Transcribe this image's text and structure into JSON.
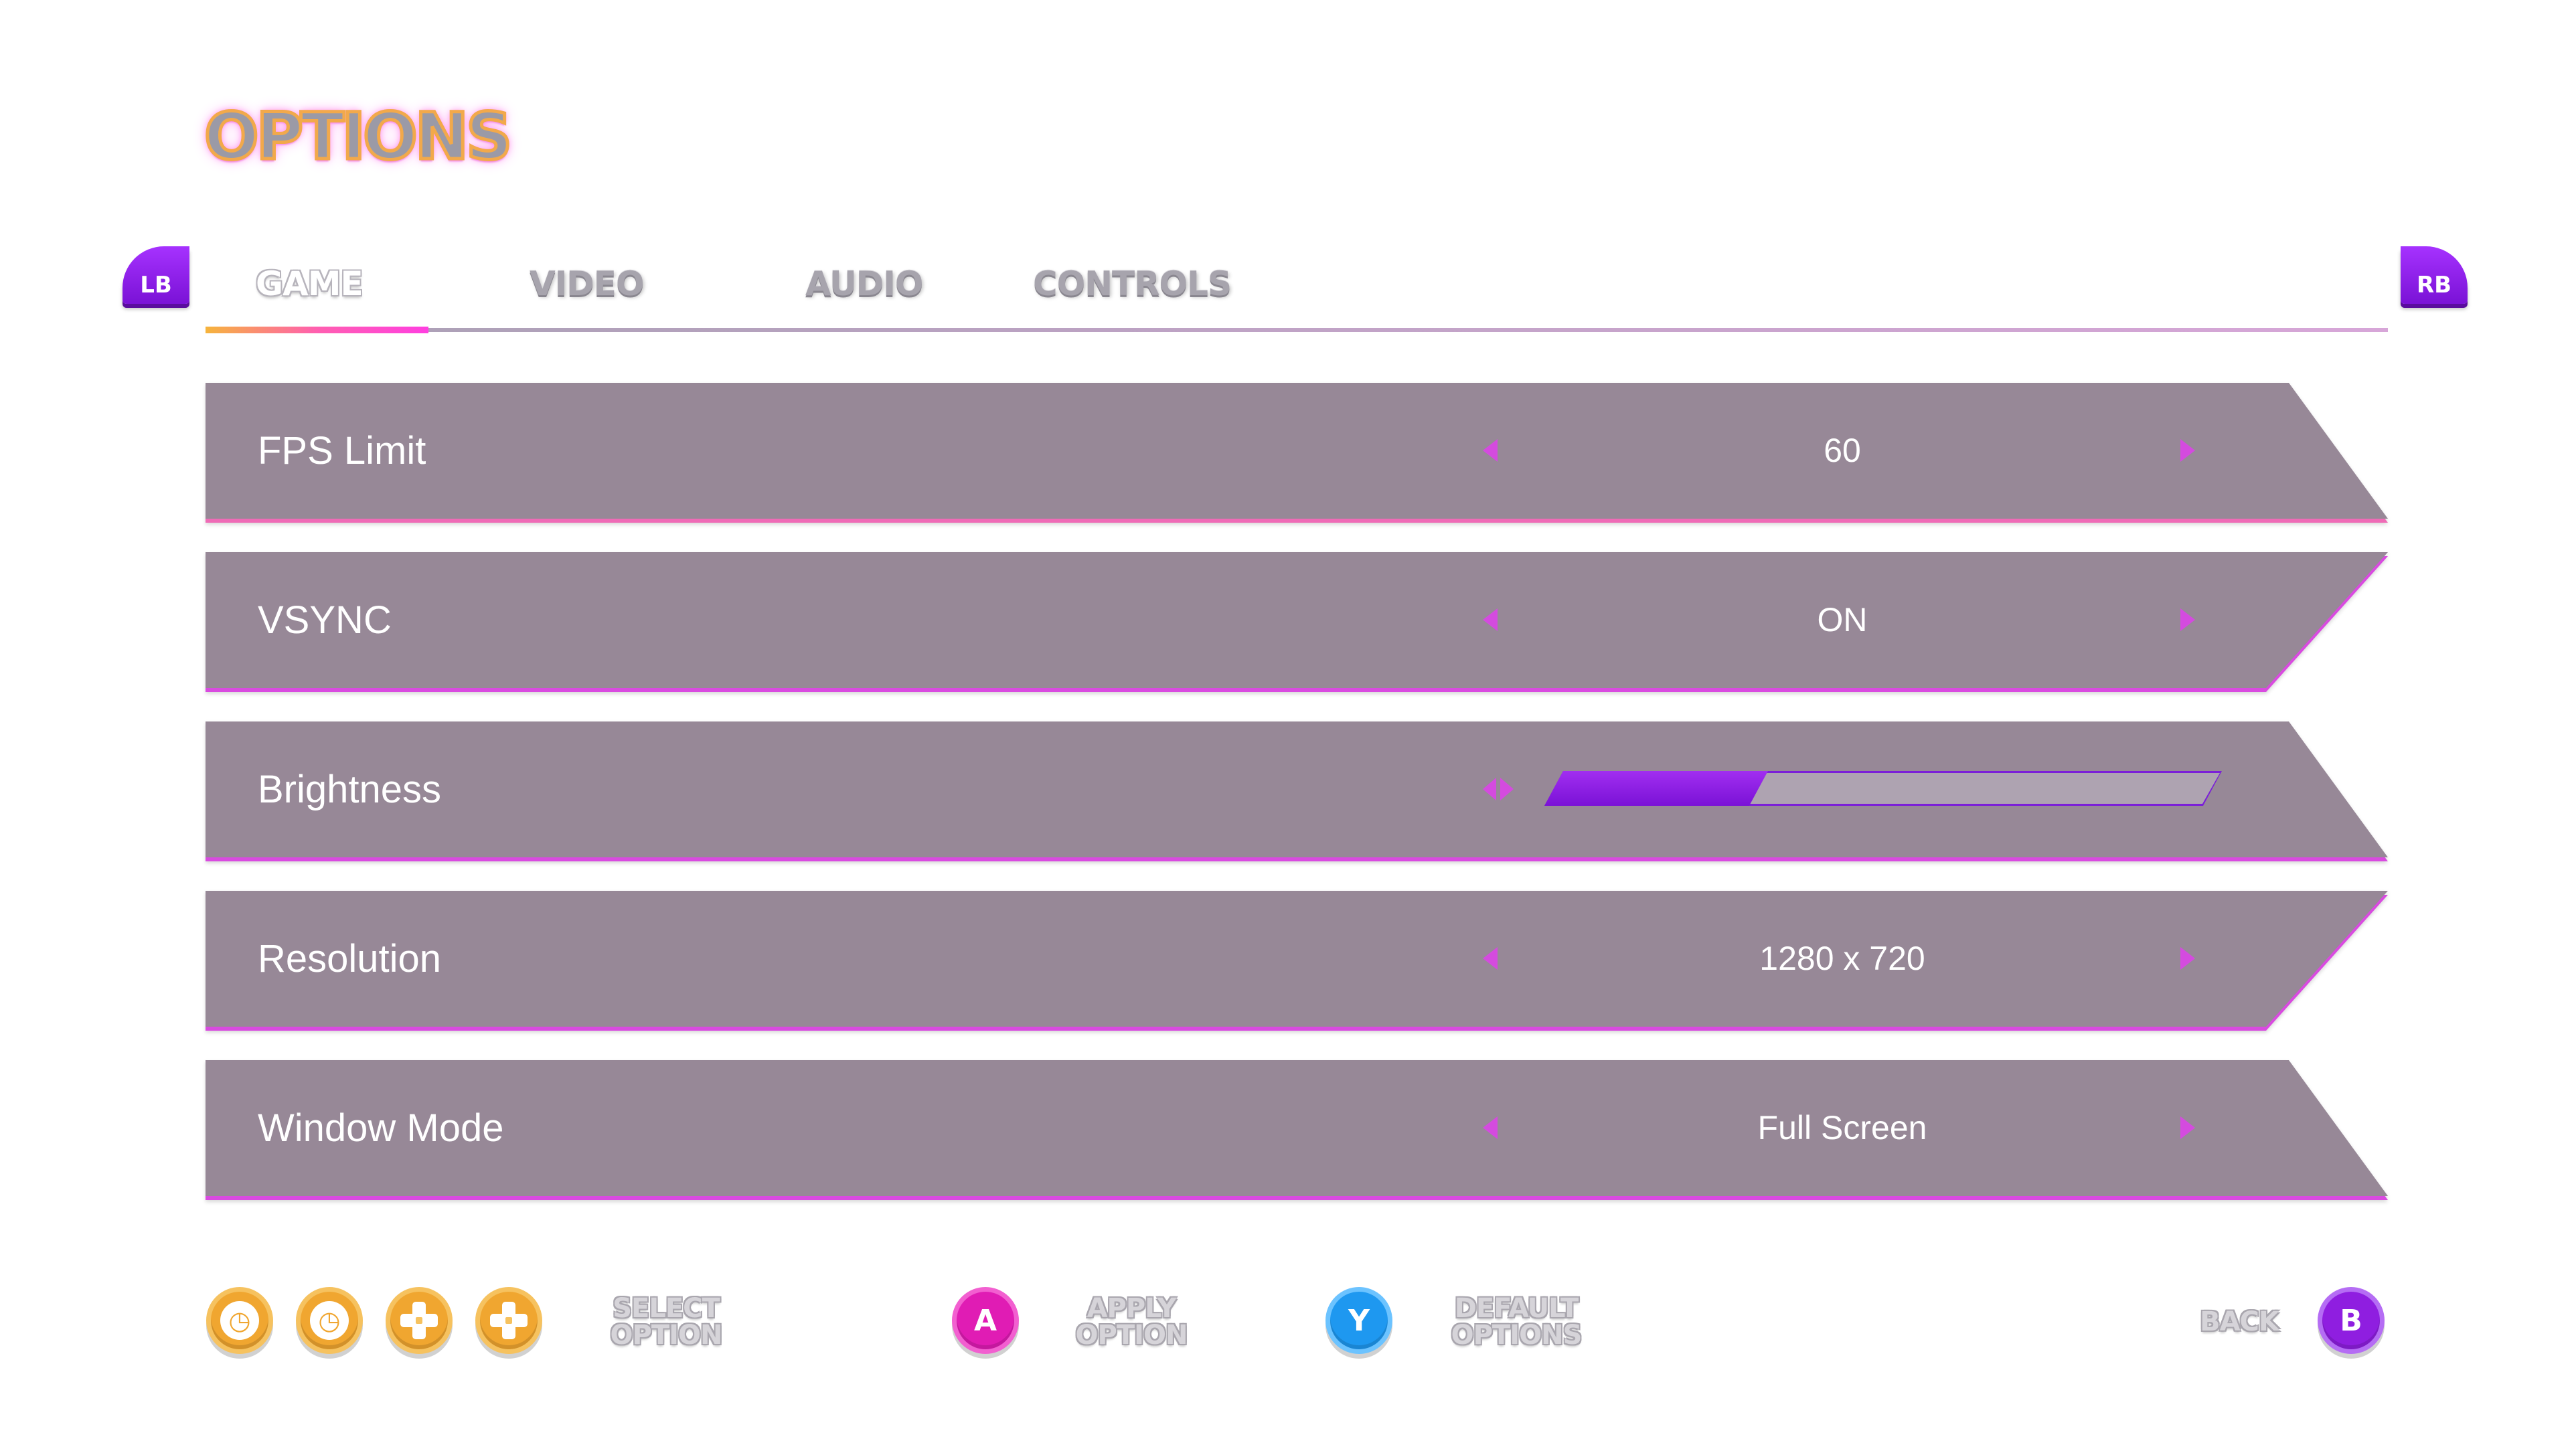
{
  "menu": {
    "title": "OPTIONS"
  },
  "bumpers": {
    "left": "LB",
    "right": "RB"
  },
  "tabs": [
    {
      "label": "GAME",
      "active": true
    },
    {
      "label": "VIDEO",
      "active": false
    },
    {
      "label": "AUDIO",
      "active": false
    },
    {
      "label": "CONTROLS",
      "active": false
    }
  ],
  "settings": [
    {
      "label": "FPS Limit",
      "value": "60"
    },
    {
      "label": "VSYNC",
      "value": "ON"
    },
    {
      "label": "Brightness",
      "level": 0.33
    },
    {
      "label": "Resolution",
      "value": "1280 x 720"
    },
    {
      "label": "Window Mode",
      "value": "Full Screen"
    }
  ],
  "footer": {
    "select": {
      "line1": "SELECT",
      "line2": "OPTION",
      "icons": [
        "left-stick-icon",
        "left-stick-press-icon",
        "dpad-icon",
        "dpad-icon"
      ]
    },
    "apply": {
      "button": "A",
      "line1": "APPLY",
      "line2": "OPTION"
    },
    "defaults": {
      "button": "Y",
      "line1": "DEFAULT",
      "line2": "OPTIONS"
    },
    "back": {
      "button": "B",
      "label": "BACK"
    }
  },
  "colors": {
    "row": "#978897",
    "accent": "#d44bdf",
    "slider_fill": "#8a1fe4",
    "gold_glyph": "#f0a630",
    "a_button": "#e01cb4",
    "y_button": "#1e98f0",
    "b_button": "#8f1ee0"
  }
}
